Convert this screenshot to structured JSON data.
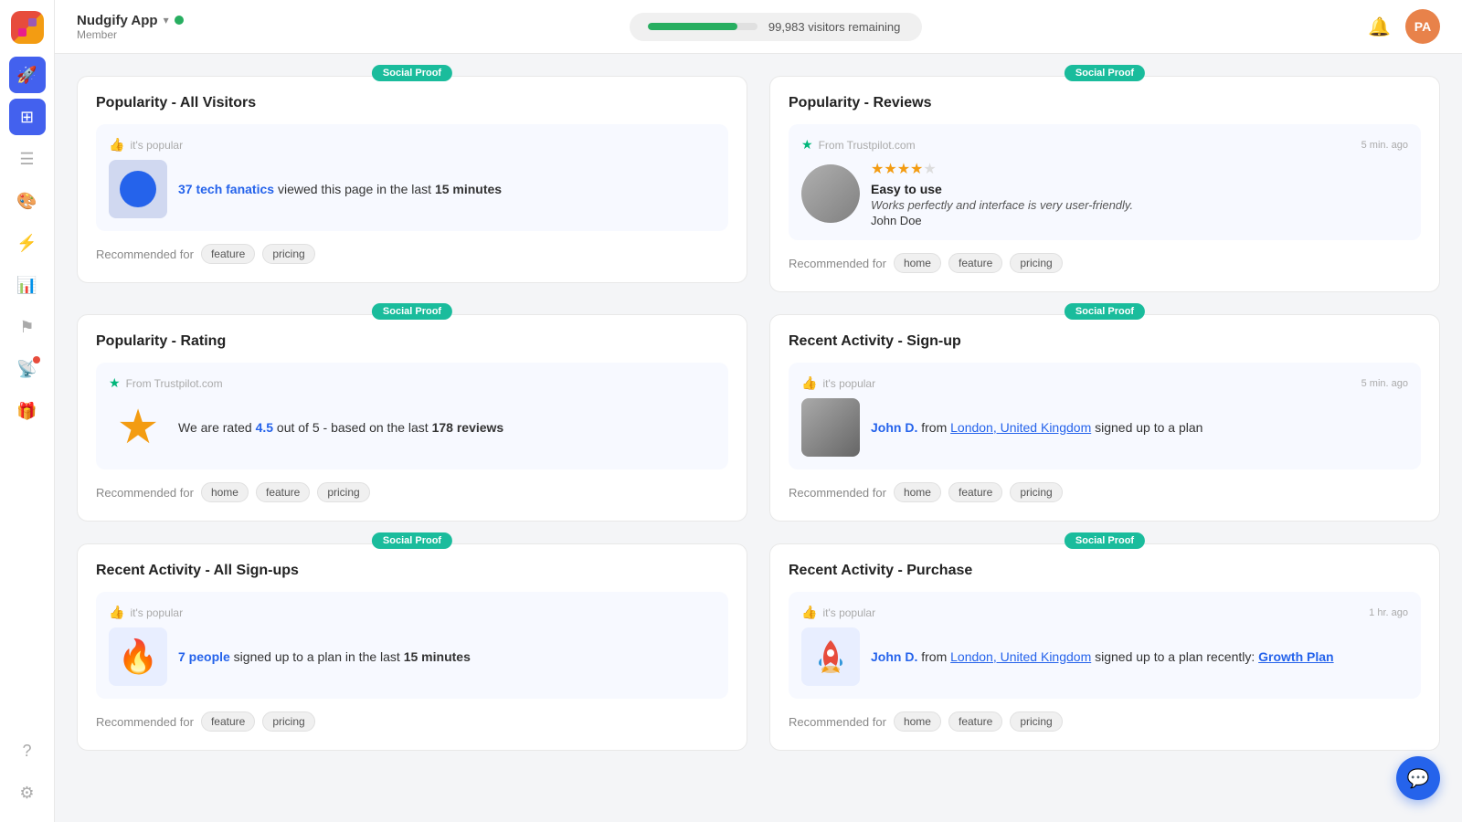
{
  "app": {
    "name": "Nudgify App",
    "sub": "Member",
    "status": "online"
  },
  "header": {
    "visitors_label": "99,983 visitors remaining",
    "progress_percent": 82
  },
  "sidebar": {
    "items": [
      {
        "name": "rocket",
        "icon": "🚀",
        "active": false
      },
      {
        "name": "dashboard",
        "icon": "▦",
        "active": true
      },
      {
        "name": "list",
        "icon": "☰",
        "active": false
      },
      {
        "name": "palette",
        "icon": "🎨",
        "active": false
      },
      {
        "name": "activity",
        "icon": "⚡",
        "active": false
      },
      {
        "name": "chart",
        "icon": "📊",
        "active": false
      },
      {
        "name": "flag",
        "icon": "⚑",
        "active": false
      },
      {
        "name": "broadcast",
        "icon": "📡",
        "active": false
      },
      {
        "name": "gift",
        "icon": "🎁",
        "active": false
      }
    ],
    "bottom": [
      {
        "name": "help",
        "icon": "?"
      },
      {
        "name": "settings",
        "icon": "⚙"
      }
    ]
  },
  "cards": [
    {
      "id": "popularity-visitors",
      "badge": "Social Proof",
      "title": "Popularity - All Visitors",
      "notif_label": "it's popular",
      "notif_text_pre": "",
      "notif_highlight": "37 tech fanatics",
      "notif_text_post": " viewed this page in the last ",
      "notif_bold": "15 minutes",
      "type": "visitors",
      "tags_label": "Recommended for",
      "tags": [
        "feature",
        "pricing"
      ]
    },
    {
      "id": "popularity-reviews",
      "badge": "Social Proof",
      "title": "Popularity - Reviews",
      "from_label": "From Trustpilot.com",
      "time": "5 min. ago",
      "stars": 4,
      "review_title": "Easy to use",
      "review_body": "Works perfectly and interface is very user-friendly.",
      "review_author": "John Doe",
      "type": "review",
      "tags_label": "Recommended for",
      "tags": [
        "home",
        "feature",
        "pricing"
      ]
    },
    {
      "id": "popularity-rating",
      "badge": "Social Proof",
      "title": "Popularity - Rating",
      "from_label": "From Trustpilot.com",
      "type": "rating",
      "notif_text_pre": "We are rated ",
      "notif_highlight": "4.5",
      "notif_text_post": " out of 5 - based on the last ",
      "notif_bold": "178 reviews",
      "tags_label": "Recommended for",
      "tags": [
        "home",
        "feature",
        "pricing"
      ]
    },
    {
      "id": "recent-signup",
      "badge": "Social Proof",
      "title": "Recent Activity - Sign-up",
      "notif_label": "it's popular",
      "time": "5 min. ago",
      "type": "signup",
      "person_name": "John D.",
      "person_text_pre": " from ",
      "person_link": "London, United Kingdom",
      "person_text_post": " signed up to a plan",
      "tags_label": "Recommended for",
      "tags": [
        "home",
        "feature",
        "pricing"
      ]
    },
    {
      "id": "recent-all-signups",
      "badge": "Social Proof",
      "title": "Recent Activity - All Sign-ups",
      "notif_label": "it's popular",
      "type": "all-signups",
      "notif_highlight": "7 people",
      "notif_text_post": " signed up to a plan in the last ",
      "notif_bold": "15 minutes",
      "tags_label": "Recommended for",
      "tags": [
        "feature",
        "pricing"
      ]
    },
    {
      "id": "recent-purchase",
      "badge": "Social Proof",
      "title": "Recent Activity - Purchase",
      "notif_label": "it's popular",
      "time": "1 hr. ago",
      "type": "purchase",
      "person_name": "John D.",
      "person_text_pre": " from ",
      "person_link": "London, United Kingdom",
      "person_text_post": " signed up to a plan recently: ",
      "person_plan": "Growth Plan",
      "tags_label": "Recommended for",
      "tags": [
        "home",
        "feature",
        "pricing"
      ]
    }
  ],
  "avatar": "PA"
}
